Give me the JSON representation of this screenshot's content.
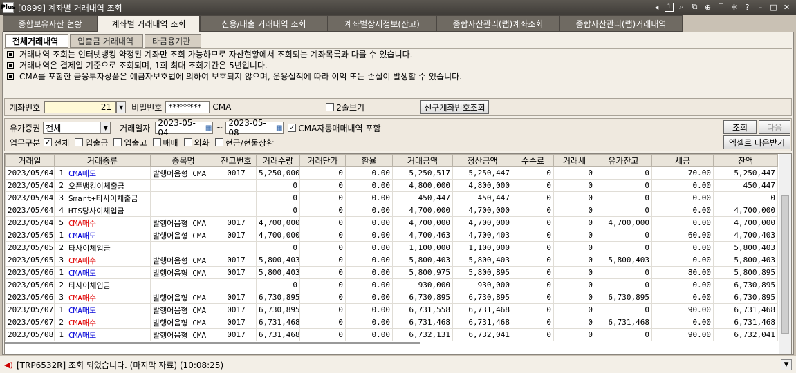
{
  "window": {
    "logo": "Plus",
    "title": "[0899] 계좌별 거래내역 조회",
    "page_no": "1"
  },
  "main_tabs": [
    {
      "label": "종합보유자산 현황"
    },
    {
      "label": "계좌별 거래내역 조회"
    },
    {
      "label": "신용/대출 거래내역 조회"
    },
    {
      "label": "계좌별상세정보(잔고)"
    },
    {
      "label": "종합자산관리(랩)계좌조회"
    },
    {
      "label": "종합자산관리(랩)거래내역"
    }
  ],
  "sub_tabs": [
    {
      "label": "전체거래내역"
    },
    {
      "label": "입출금 거래내역"
    },
    {
      "label": "타금융기관"
    }
  ],
  "notices": [
    "거래내역 조회는 인터넷뱅킹 약정된 계좌만 조회 가능하므로 자산현황에서 조회되는 계좌목록과 다를 수 있습니다.",
    "거래내역은 결제일 기준으로 조회되며, 1회 최대 조회기간은 5년입니다.",
    "CMA를 포함한 금융투자상품은 예금자보호법에 의하여 보호되지 않으며, 운용실적에 따라 이익 또는 손실이 발생할 수 있습니다."
  ],
  "account": {
    "label": "계좌번호",
    "value": "21",
    "password_label": "비밀번호",
    "password_value": "********",
    "account_type": "CMA",
    "two_line_label": "2줄보기",
    "new_account_button": "신구계좌번호조회"
  },
  "filter": {
    "securities_label": "유가증권",
    "securities_value": "전체",
    "date_label": "거래일자",
    "date_from": "2023-05-04",
    "date_sep": "~",
    "date_to": "2023-05-08",
    "cma_auto_label": "CMA자동매매내역 포함",
    "biz_label": "업무구분",
    "options": [
      "전체",
      "입출금",
      "입출고",
      "매매",
      "외화",
      "현금/현물상환"
    ],
    "search_button": "조회",
    "next_button": "다음",
    "excel_button": "엑셀로 다운받기"
  },
  "table": {
    "columns": [
      "거래일",
      "거래종류",
      "종목명",
      "잔고번호",
      "거래수량",
      "거래단가",
      "환율",
      "거래금액",
      "정산금액",
      "수수료",
      "거래세",
      "유가잔고",
      "세금",
      "잔액"
    ],
    "rows": [
      {
        "date": "2023/05/04",
        "no": "1",
        "type": "CMA매도",
        "color": "blue",
        "item": "발행어음형 CMA",
        "bal_no": "0017",
        "qty": "5,250,000",
        "price": "0",
        "fx": "0.00",
        "amount": "5,250,517",
        "settle": "5,250,447",
        "fee": "0",
        "tax_tr": "0",
        "sec_bal": "0",
        "tax": "70.00",
        "balance": "5,250,447"
      },
      {
        "date": "2023/05/04",
        "no": "2",
        "type": "오픈뱅킹이체출금",
        "color": "black",
        "item": "",
        "bal_no": "",
        "qty": "0",
        "price": "0",
        "fx": "0.00",
        "amount": "4,800,000",
        "settle": "4,800,000",
        "fee": "0",
        "tax_tr": "0",
        "sec_bal": "0",
        "tax": "0.00",
        "balance": "450,447"
      },
      {
        "date": "2023/05/04",
        "no": "3",
        "type": "Smart+타사이체출금",
        "color": "black",
        "item": "",
        "bal_no": "",
        "qty": "0",
        "price": "0",
        "fx": "0.00",
        "amount": "450,447",
        "settle": "450,447",
        "fee": "0",
        "tax_tr": "0",
        "sec_bal": "0",
        "tax": "0.00",
        "balance": "0"
      },
      {
        "date": "2023/05/04",
        "no": "4",
        "type": "HTS당사이체입금",
        "color": "black",
        "item": "",
        "bal_no": "",
        "qty": "0",
        "price": "0",
        "fx": "0.00",
        "amount": "4,700,000",
        "settle": "4,700,000",
        "fee": "0",
        "tax_tr": "0",
        "sec_bal": "0",
        "tax": "0.00",
        "balance": "4,700,000"
      },
      {
        "date": "2023/05/04",
        "no": "5",
        "type": "CMA매수",
        "color": "red",
        "item": "발행어음형 CMA",
        "bal_no": "0017",
        "qty": "4,700,000",
        "price": "0",
        "fx": "0.00",
        "amount": "4,700,000",
        "settle": "4,700,000",
        "fee": "0",
        "tax_tr": "0",
        "sec_bal": "4,700,000",
        "tax": "0.00",
        "balance": "4,700,000"
      },
      {
        "date": "2023/05/05",
        "no": "1",
        "type": "CMA매도",
        "color": "blue",
        "item": "발행어음형 CMA",
        "bal_no": "0017",
        "qty": "4,700,000",
        "price": "0",
        "fx": "0.00",
        "amount": "4,700,463",
        "settle": "4,700,403",
        "fee": "0",
        "tax_tr": "0",
        "sec_bal": "0",
        "tax": "60.00",
        "balance": "4,700,403"
      },
      {
        "date": "2023/05/05",
        "no": "2",
        "type": "타사이체입금",
        "color": "black",
        "item": "",
        "bal_no": "",
        "qty": "0",
        "price": "0",
        "fx": "0.00",
        "amount": "1,100,000",
        "settle": "1,100,000",
        "fee": "0",
        "tax_tr": "0",
        "sec_bal": "0",
        "tax": "0.00",
        "balance": "5,800,403"
      },
      {
        "date": "2023/05/05",
        "no": "3",
        "type": "CMA매수",
        "color": "red",
        "item": "발행어음형 CMA",
        "bal_no": "0017",
        "qty": "5,800,403",
        "price": "0",
        "fx": "0.00",
        "amount": "5,800,403",
        "settle": "5,800,403",
        "fee": "0",
        "tax_tr": "0",
        "sec_bal": "5,800,403",
        "tax": "0.00",
        "balance": "5,800,403"
      },
      {
        "date": "2023/05/06",
        "no": "1",
        "type": "CMA매도",
        "color": "blue",
        "item": "발행어음형 CMA",
        "bal_no": "0017",
        "qty": "5,800,403",
        "price": "0",
        "fx": "0.00",
        "amount": "5,800,975",
        "settle": "5,800,895",
        "fee": "0",
        "tax_tr": "0",
        "sec_bal": "0",
        "tax": "80.00",
        "balance": "5,800,895"
      },
      {
        "date": "2023/05/06",
        "no": "2",
        "type": "타사이체입금",
        "color": "black",
        "item": "",
        "bal_no": "",
        "qty": "0",
        "price": "0",
        "fx": "0.00",
        "amount": "930,000",
        "settle": "930,000",
        "fee": "0",
        "tax_tr": "0",
        "sec_bal": "0",
        "tax": "0.00",
        "balance": "6,730,895"
      },
      {
        "date": "2023/05/06",
        "no": "3",
        "type": "CMA매수",
        "color": "red",
        "item": "발행어음형 CMA",
        "bal_no": "0017",
        "qty": "6,730,895",
        "price": "0",
        "fx": "0.00",
        "amount": "6,730,895",
        "settle": "6,730,895",
        "fee": "0",
        "tax_tr": "0",
        "sec_bal": "6,730,895",
        "tax": "0.00",
        "balance": "6,730,895"
      },
      {
        "date": "2023/05/07",
        "no": "1",
        "type": "CMA매도",
        "color": "blue",
        "item": "발행어음형 CMA",
        "bal_no": "0017",
        "qty": "6,730,895",
        "price": "0",
        "fx": "0.00",
        "amount": "6,731,558",
        "settle": "6,731,468",
        "fee": "0",
        "tax_tr": "0",
        "sec_bal": "0",
        "tax": "90.00",
        "balance": "6,731,468"
      },
      {
        "date": "2023/05/07",
        "no": "2",
        "type": "CMA매수",
        "color": "red",
        "item": "발행어음형 CMA",
        "bal_no": "0017",
        "qty": "6,731,468",
        "price": "0",
        "fx": "0.00",
        "amount": "6,731,468",
        "settle": "6,731,468",
        "fee": "0",
        "tax_tr": "0",
        "sec_bal": "6,731,468",
        "tax": "0.00",
        "balance": "6,731,468"
      },
      {
        "date": "2023/05/08",
        "no": "1",
        "type": "CMA매도",
        "color": "blue",
        "item": "발행어음형 CMA",
        "bal_no": "0017",
        "qty": "6,731,468",
        "price": "0",
        "fx": "0.00",
        "amount": "6,732,131",
        "settle": "6,732,041",
        "fee": "0",
        "tax_tr": "0",
        "sec_bal": "0",
        "tax": "90.00",
        "balance": "6,732,041"
      }
    ]
  },
  "status": {
    "text": "[TRP6532R] 조회 되었습니다. (마지막 자료) (10:08:25)"
  },
  "colors": {
    "buy": "#e00000",
    "sell": "#0000d8",
    "titlebar": "#4a4641",
    "tab_inactive": "#6f6a62"
  }
}
